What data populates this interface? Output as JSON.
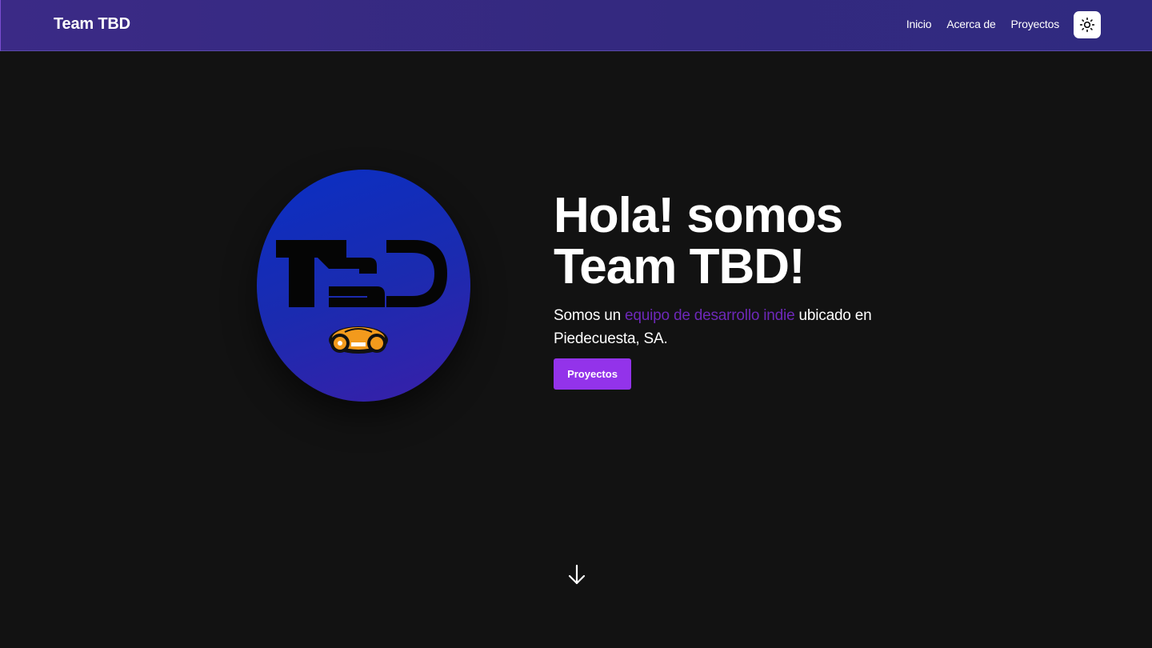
{
  "navbar": {
    "brand": "Team TBD",
    "links": [
      "Inicio",
      "Acerca de",
      "Proyectos"
    ],
    "theme_toggle_icon": "sun-icon"
  },
  "hero": {
    "title_line1": "Hola! somos",
    "title_line2": "Team TBD!",
    "text_before": "Somos un ",
    "text_highlight": "equipo de desarrollo indie",
    "text_after": " ubicado en Piedecuesta, SA.",
    "cta_label": "Proyectos",
    "logo_text": "TBD",
    "scroll_icon": "arrow-down-icon"
  },
  "colors": {
    "navbar": "#352a82",
    "background": "#121212",
    "accent": "#9333ea",
    "highlight_text": "#6d28b8"
  }
}
